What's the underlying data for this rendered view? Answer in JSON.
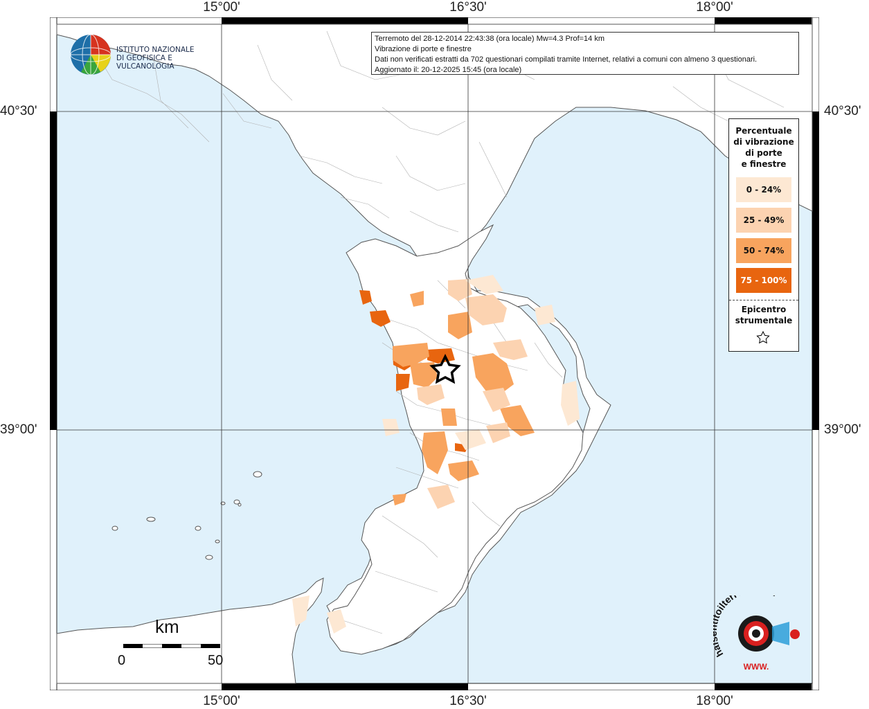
{
  "map": {
    "lon_ticks": [
      "15°00'",
      "16°30'",
      "18°00'"
    ],
    "lat_ticks": [
      "40°30'",
      "39°00'"
    ],
    "colors": {
      "sea": "#e0f1fb",
      "land": "#ffffff",
      "border": "#b0b0b0",
      "coast": "#555555",
      "grid": "#333333"
    }
  },
  "info": {
    "line1": "Terremoto del 28-12-2014 22:43:38 (ora locale) Mw=4.3 Prof=14 km",
    "line2": "Vibrazione di porte e finestre",
    "line3": "Dati non verificati estratti da 702 questionari compilati tramite Internet, relativi a comuni con almeno 3 questionari.",
    "line4": "Aggiornato il: 20-12-2025 15:45 (ora locale)"
  },
  "logo": {
    "line1": "ISTITUTO NAZIONALE",
    "line2": "DI GEOFISICA E VULCANOLOGIA"
  },
  "legend": {
    "title_lines": [
      "Percentuale",
      "di vibrazione",
      "di porte",
      "e finestre"
    ],
    "items": [
      {
        "label": "0 - 24%",
        "color": "#fde8d3",
        "text_color": "#111111"
      },
      {
        "label": "25 - 49%",
        "color": "#fcd3b1",
        "text_color": "#111111"
      },
      {
        "label": "50 - 74%",
        "color": "#f8a45e",
        "text_color": "#111111"
      },
      {
        "label": "75 - 100%",
        "color": "#e8650f",
        "text_color": "#ffffff"
      }
    ],
    "epicenter_lines": [
      "Epicentro",
      "strumentale"
    ]
  },
  "scale": {
    "unit": "km",
    "zero": "0",
    "max": "50"
  },
  "watermark": {
    "text": "haisentitoilterremoto.it",
    "url": "WWW."
  }
}
